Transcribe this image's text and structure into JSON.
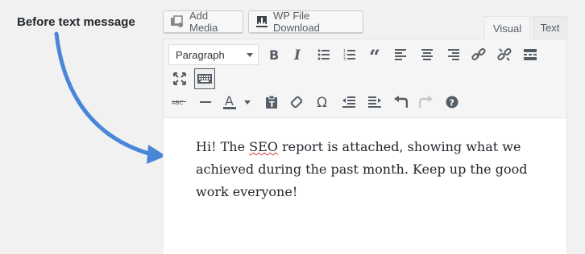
{
  "annotation": {
    "label": "Before text message",
    "arrow_color": "#4a86d8"
  },
  "media_buttons": {
    "add_media": "Add Media",
    "wp_file_download": "WP File Download"
  },
  "tabs": {
    "visual": "Visual",
    "text": "Text",
    "active": "Visual"
  },
  "toolbar": {
    "format_selected": "Paragraph",
    "row1_icons": [
      "bold-icon",
      "italic-icon",
      "bulleted-list-icon",
      "numbered-list-icon",
      "blockquote-icon",
      "align-left-icon",
      "align-center-icon",
      "align-right-icon",
      "insert-link-icon",
      "remove-link-icon",
      "read-more-icon",
      "fullscreen-icon",
      "toolbar-toggle-icon"
    ],
    "row2_icons": [
      "strikethrough-icon",
      "horizontal-line-icon",
      "text-color-icon",
      "paste-as-text-icon",
      "clear-formatting-icon",
      "special-character-icon",
      "outdent-icon",
      "indent-icon",
      "undo-icon",
      "redo-icon",
      "help-icon"
    ]
  },
  "editor": {
    "text_before": "Hi! The ",
    "text_spell": "SEO",
    "text_after": " report is attached, showing what we achieved during the past month. Keep up the good work everyone!"
  }
}
